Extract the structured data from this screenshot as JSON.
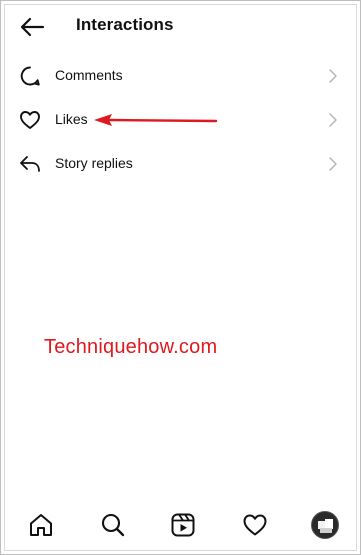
{
  "header": {
    "title": "Interactions",
    "back_icon": "arrow-left-icon"
  },
  "items": [
    {
      "label": "Comments",
      "icon": "comment-bubble-icon"
    },
    {
      "label": "Likes",
      "icon": "heart-icon"
    },
    {
      "label": "Story replies",
      "icon": "reply-arrow-icon"
    }
  ],
  "annotation": {
    "arrow_color": "#e0191f",
    "target": "Likes"
  },
  "watermark": {
    "text": "Techniquehow.com",
    "color": "#e0191f"
  },
  "bottom_nav": [
    {
      "icon": "home-icon"
    },
    {
      "icon": "search-icon"
    },
    {
      "icon": "reels-icon"
    },
    {
      "icon": "heart-icon"
    },
    {
      "icon": "profile-avatar"
    }
  ]
}
